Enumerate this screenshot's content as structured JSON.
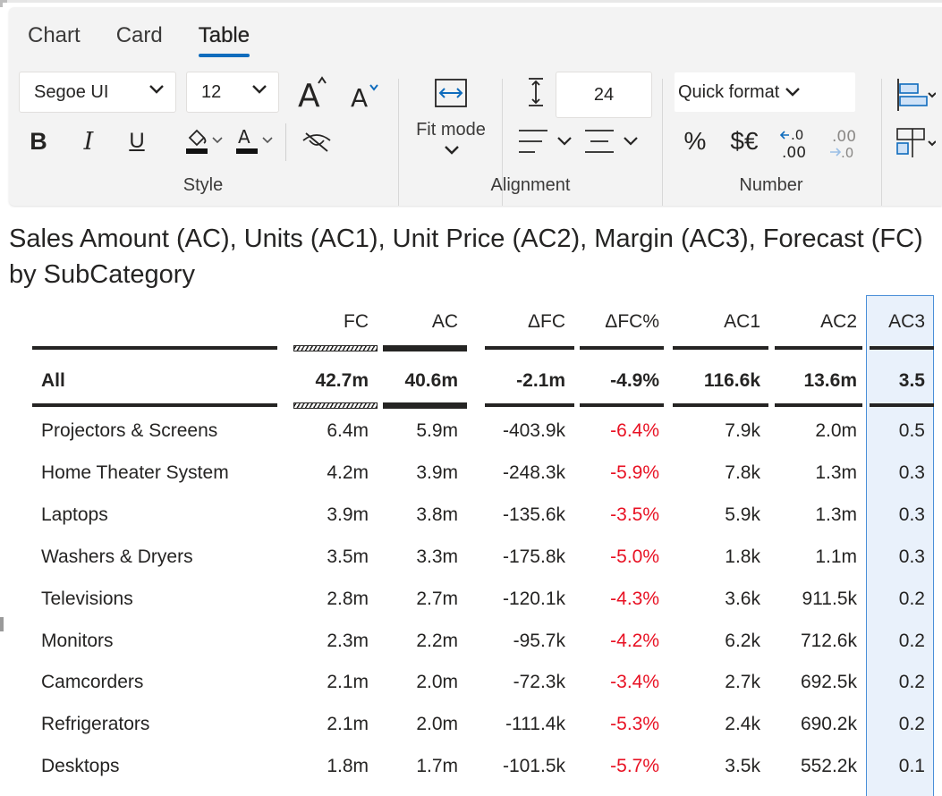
{
  "ribbon": {
    "tabs": [
      {
        "label": "Chart"
      },
      {
        "label": "Card"
      },
      {
        "label": "Table"
      }
    ],
    "active_tab": "Table",
    "font_family": "Segoe UI",
    "font_size": "12",
    "row_height": "24",
    "fit_mode_label": "Fit mode",
    "quick_format_label": "Quick format",
    "bold_label": "B",
    "italic_label": "I",
    "underline_label": "U",
    "percent_label": "%",
    "currency_label": "$€",
    "groups": {
      "style": "Style",
      "alignment": "Alignment",
      "number": "Number"
    },
    "accent_color": "#0f6cbd"
  },
  "visual": {
    "title_line1": "Sales Amount (AC), Units (AC1), Unit Price (AC2), Margin (AC3), Forecast (FC)",
    "title_line2": "by SubCategory"
  },
  "table": {
    "columns": [
      "FC",
      "AC",
      "ΔFC",
      "ΔFC%",
      "AC1",
      "AC2",
      "AC3"
    ],
    "total": {
      "label": "All",
      "values": [
        "42.7m",
        "40.6m",
        "-2.1m",
        "-4.9%",
        "116.6k",
        "13.6m",
        "3.5"
      ]
    },
    "rows": [
      {
        "label": "Projectors & Screens",
        "values": [
          "6.4m",
          "5.9m",
          "-403.9k",
          "-6.4%",
          "7.9k",
          "2.0m",
          "0.5"
        ]
      },
      {
        "label": "Home Theater System",
        "values": [
          "4.2m",
          "3.9m",
          "-248.3k",
          "-5.9%",
          "7.8k",
          "1.3m",
          "0.3"
        ]
      },
      {
        "label": "Laptops",
        "values": [
          "3.9m",
          "3.8m",
          "-135.6k",
          "-3.5%",
          "5.9k",
          "1.3m",
          "0.3"
        ]
      },
      {
        "label": "Washers & Dryers",
        "values": [
          "3.5m",
          "3.3m",
          "-175.8k",
          "-5.0%",
          "1.8k",
          "1.1m",
          "0.3"
        ]
      },
      {
        "label": "Televisions",
        "values": [
          "2.8m",
          "2.7m",
          "-120.1k",
          "-4.3%",
          "3.6k",
          "911.5k",
          "0.2"
        ]
      },
      {
        "label": "Monitors",
        "values": [
          "2.3m",
          "2.2m",
          "-95.7k",
          "-4.2%",
          "6.2k",
          "712.6k",
          "0.2"
        ]
      },
      {
        "label": "Camcorders",
        "values": [
          "2.1m",
          "2.0m",
          "-72.3k",
          "-3.4%",
          "2.7k",
          "692.5k",
          "0.2"
        ]
      },
      {
        "label": "Refrigerators",
        "values": [
          "2.1m",
          "2.0m",
          "-111.4k",
          "-5.3%",
          "2.4k",
          "690.2k",
          "0.2"
        ]
      },
      {
        "label": "Desktops",
        "values": [
          "1.8m",
          "1.7m",
          "-101.5k",
          "-5.7%",
          "3.5k",
          "552.2k",
          "0.1"
        ]
      }
    ],
    "negative_color": "#e81123",
    "selected_column": "AC3"
  }
}
